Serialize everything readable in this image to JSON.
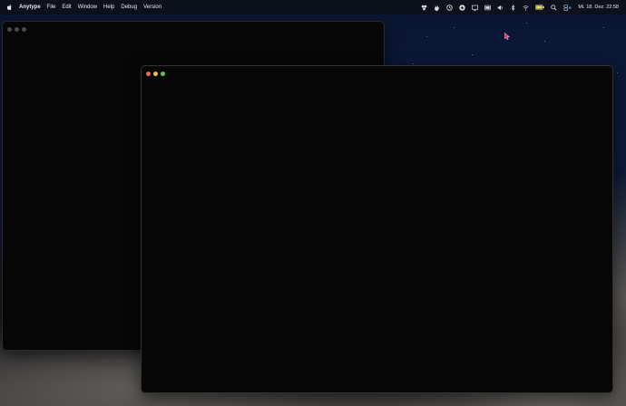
{
  "menubar": {
    "app_name": "Anytype",
    "menus": [
      "File",
      "Edit",
      "Window",
      "Help",
      "Debug",
      "Version"
    ],
    "status_icons": [
      "stats-icon",
      "flame-icon",
      "clock-icon",
      "soccer-icon",
      "screen-mirror-icon",
      "display-icon",
      "volume-icon",
      "bluetooth-icon",
      "wifi-icon",
      "battery-icon",
      "search-icon",
      "control-center-icon"
    ],
    "clock": "Mi. 18. Dez. 22:58"
  },
  "colors": {
    "accent_cursor": "#e0307a",
    "window_bg": "#070707",
    "close": "#ed6a5e",
    "minimize": "#f5bf4f",
    "zoom": "#61c554"
  }
}
